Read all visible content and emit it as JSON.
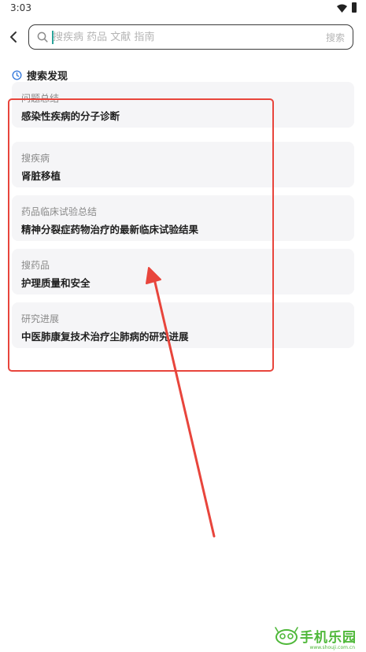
{
  "status_bar": {
    "time": "3:03"
  },
  "search": {
    "placeholder": "搜疾病 药品 文献 指南",
    "value": "",
    "submit_label": "搜索"
  },
  "discover": {
    "title": "搜索发现",
    "items": [
      {
        "category": "问题总结",
        "title": "感染性疾病的分子诊断"
      },
      {
        "category": "搜疾病",
        "title": "肾脏移植"
      },
      {
        "category": "药品临床试验总结",
        "title": "精神分裂症药物治疗的最新临床试验结果"
      },
      {
        "category": "搜药品",
        "title": "护理质量和安全"
      },
      {
        "category": "研究进展",
        "title": "中医肺康复技术治疗尘肺病的研究进展"
      }
    ]
  },
  "annotation": {
    "color": "#e8453c"
  },
  "watermark": {
    "text": "手机乐园",
    "url": "www.shouji.com.cn",
    "color": "#4fb83a"
  }
}
